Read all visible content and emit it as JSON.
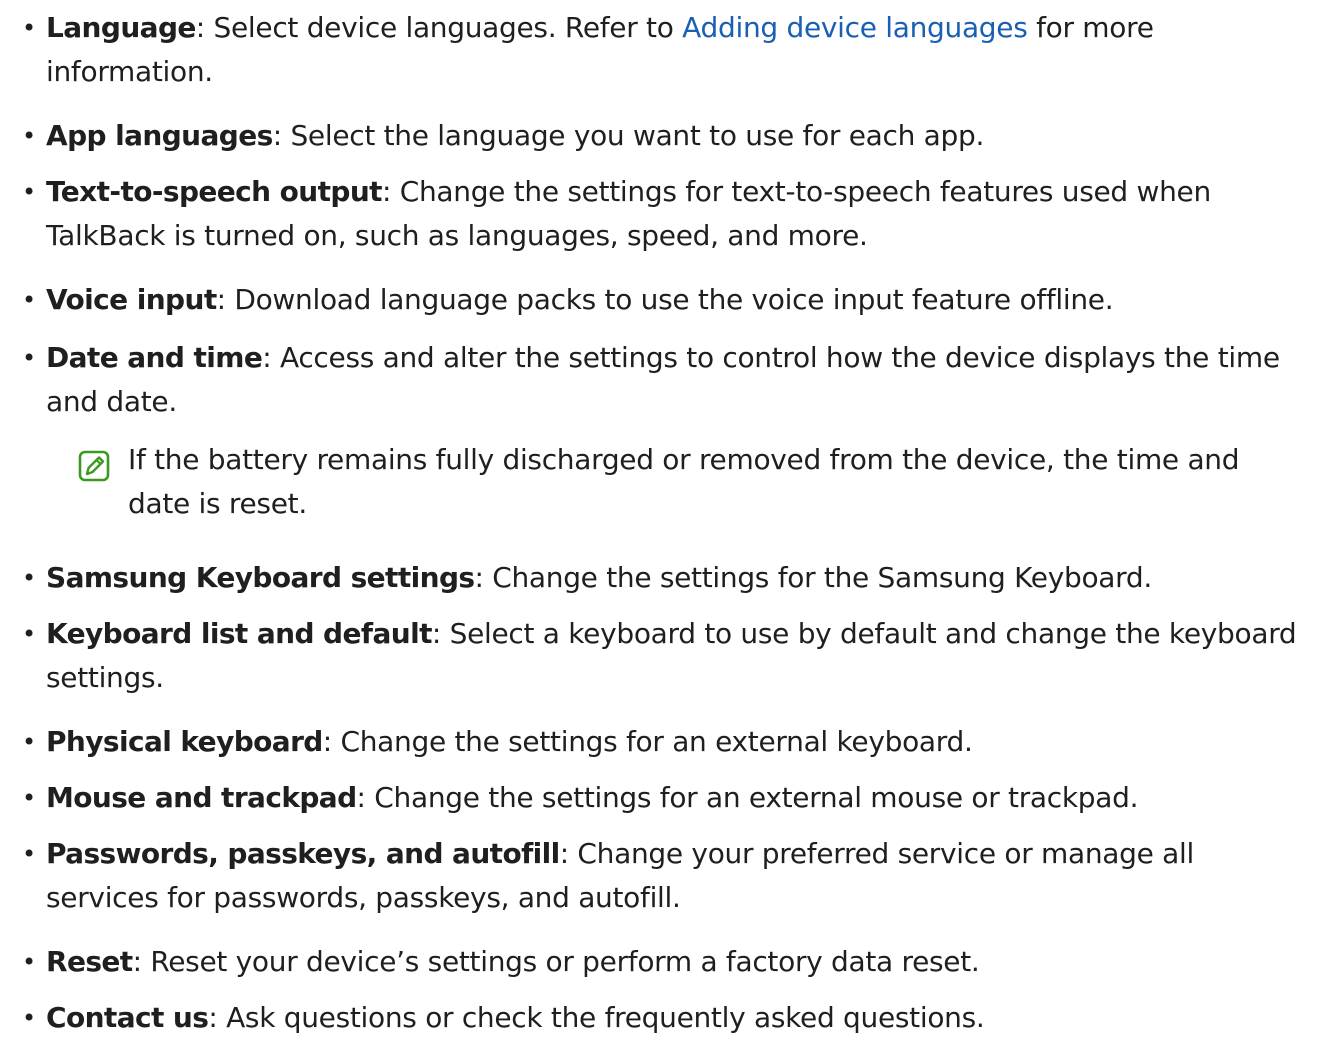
{
  "items": [
    {
      "term": "Language",
      "sep": ": ",
      "text_before": "Select device languages. Refer to ",
      "link": "Adding device languages",
      "text_after": " for more information."
    },
    {
      "term": "App languages",
      "sep": ": ",
      "text": "Select the language you want to use for each app."
    },
    {
      "term": "Text-to-speech output",
      "sep": ": ",
      "text": "Change the settings for text-to-speech features used when TalkBack is turned on, such as languages, speed, and more."
    },
    {
      "term": "Voice input",
      "sep": ": ",
      "text": "Download language packs to use the voice input feature offline."
    },
    {
      "term": "Date and time",
      "sep": ": ",
      "text": "Access and alter the settings to control how the device displays the time and date."
    },
    {
      "term": "Samsung Keyboard settings",
      "sep": ": ",
      "text": "Change the settings for the Samsung Keyboard."
    },
    {
      "term": "Keyboard list and default",
      "sep": ": ",
      "text": "Select a keyboard to use by default and change the keyboard settings."
    },
    {
      "term": "Physical keyboard",
      "sep": ": ",
      "text": "Change the settings for an external keyboard."
    },
    {
      "term": "Mouse and trackpad",
      "sep": ": ",
      "text": "Change the settings for an external mouse or trackpad."
    },
    {
      "term": "Passwords, passkeys, and autofill",
      "sep": ": ",
      "text": "Change your preferred service or manage all services for passwords, passkeys, and autofill."
    },
    {
      "term": "Reset",
      "sep": ": ",
      "text": "Reset your device’s settings or perform a factory data reset."
    },
    {
      "term": "Contact us",
      "sep": ": ",
      "text": "Ask questions or check the frequently asked questions."
    }
  ],
  "note": {
    "icon": "note-pencil-icon",
    "text": "If the battery remains fully discharged or removed from the device, the time and date is reset."
  },
  "bullet_char": "•",
  "colors": {
    "link": "#1a5fb4",
    "note_icon": "#3a9a1f",
    "text": "#1f1f1f"
  }
}
